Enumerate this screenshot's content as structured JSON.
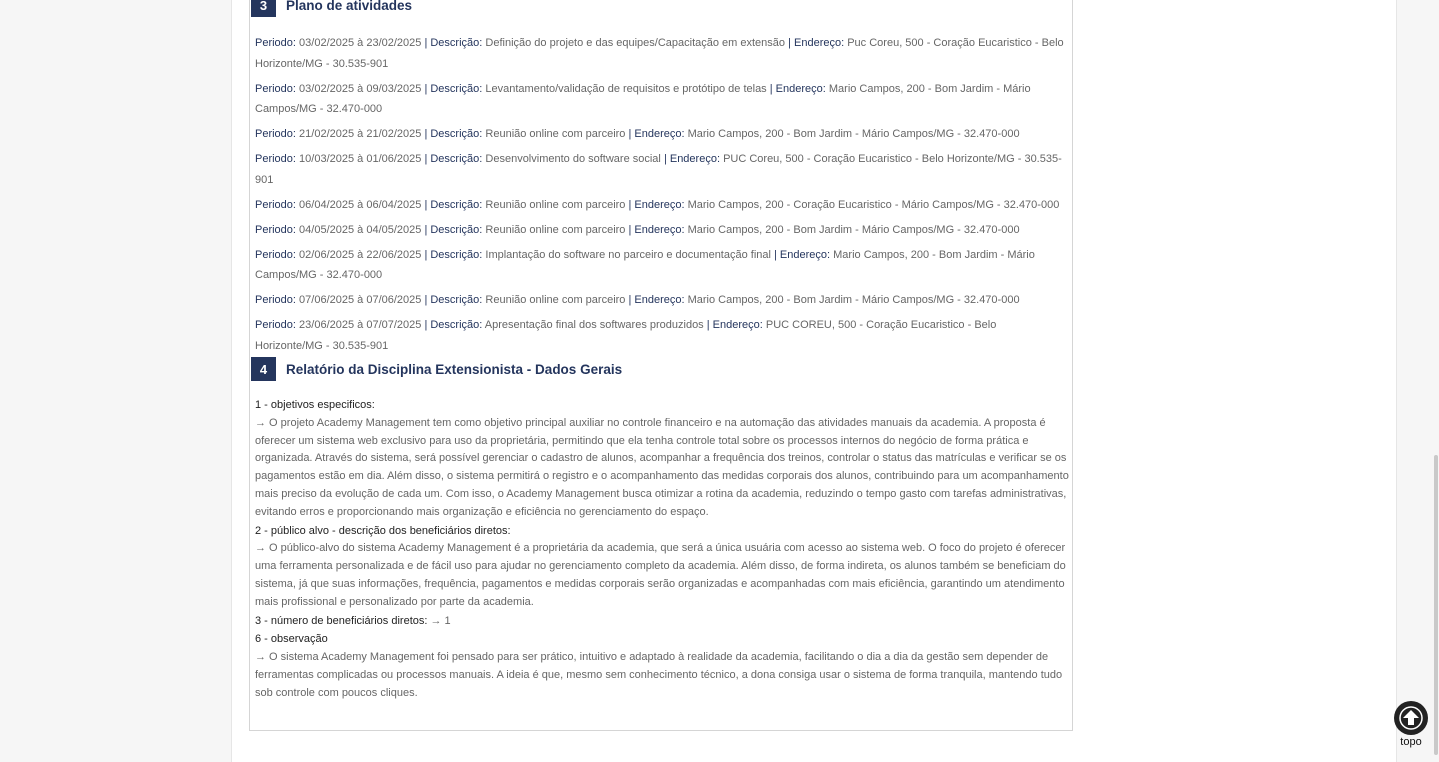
{
  "section3": {
    "number": "3",
    "title": "Plano de atividades",
    "activities": [
      {
        "period_label": "Periodo:",
        "period": "03/02/2025 à 23/02/2025",
        "desc_label": "| Descrição:",
        "desc": "Definição do projeto e das equipes/Capacitação em extensão",
        "addr_label": "| Endereço:",
        "addr": "Puc Coreu, 500 - Coração Eucaristico - Belo Horizonte/MG - 30.535-901"
      },
      {
        "period_label": "Periodo:",
        "period": "03/02/2025 à 09/03/2025",
        "desc_label": "| Descrição:",
        "desc": "Levantamento/validação de requisitos e protótipo de telas",
        "addr_label": "| Endereço:",
        "addr": "Mario Campos, 200 - Bom Jardim - Mário Campos/MG - 32.470-000"
      },
      {
        "period_label": "Periodo:",
        "period": "21/02/2025 à 21/02/2025",
        "desc_label": "| Descrição:",
        "desc": "Reunião online com parceiro",
        "addr_label": "| Endereço:",
        "addr": "Mario Campos, 200 - Bom Jardim - Mário Campos/MG - 32.470-000"
      },
      {
        "period_label": "Periodo:",
        "period": "10/03/2025 à 01/06/2025",
        "desc_label": "| Descrição:",
        "desc": "Desenvolvimento do software social",
        "addr_label": "| Endereço:",
        "addr": "PUC Coreu, 500 - Coração Eucaristico - Belo Horizonte/MG - 30.535-901"
      },
      {
        "period_label": "Periodo:",
        "period": "06/04/2025 à 06/04/2025",
        "desc_label": "| Descrição:",
        "desc": "Reunião online com parceiro",
        "addr_label": "| Endereço:",
        "addr": "Mario Campos, 200 - Coração Eucaristico - Mário Campos/MG - 32.470-000"
      },
      {
        "period_label": "Periodo:",
        "period": "04/05/2025 à 04/05/2025",
        "desc_label": "| Descrição:",
        "desc": "Reunião online com parceiro",
        "addr_label": "| Endereço:",
        "addr": "Mario Campos, 200 - Bom Jardim - Mário Campos/MG - 32.470-000"
      },
      {
        "period_label": "Periodo:",
        "period": "02/06/2025 à 22/06/2025",
        "desc_label": "| Descrição:",
        "desc": "Implantação do software no parceiro e documentação final",
        "addr_label": "| Endereço:",
        "addr": "Mario Campos, 200 - Bom Jardim - Mário Campos/MG - 32.470-000"
      },
      {
        "period_label": "Periodo:",
        "period": "07/06/2025 à 07/06/2025",
        "desc_label": "| Descrição:",
        "desc": "Reunião online com parceiro",
        "addr_label": "| Endereço:",
        "addr": "Mario Campos, 200 - Bom Jardim - Mário Campos/MG - 32.470-000"
      },
      {
        "period_label": "Periodo:",
        "period": "23/06/2025 à 07/07/2025",
        "desc_label": "| Descrição:",
        "desc": "Apresentação final dos softwares produzidos",
        "addr_label": "| Endereço:",
        "addr": "PUC COREU, 500 - Coração Eucaristico - Belo Horizonte/MG - 30.535-901"
      }
    ]
  },
  "section4": {
    "number": "4",
    "title": "Relatório da Disciplina Extensionista - Dados Gerais",
    "q1": "1 - objetivos especificos:",
    "a1": "→ O projeto Academy Management tem como objetivo principal auxiliar no controle financeiro e na automação das atividades manuais da academia. A proposta é oferecer um sistema web exclusivo para uso da proprietária, permitindo que ela tenha controle total sobre os processos internos do negócio de forma prática e organizada. Através do sistema, será possível gerenciar o cadastro de alunos, acompanhar a frequência dos treinos, controlar o status das matrículas e verificar se os pagamentos estão em dia. Além disso, o sistema permitirá o registro e o acompanhamento das medidas corporais dos alunos, contribuindo para um acompanhamento mais preciso da evolução de cada um. Com isso, o Academy Management busca otimizar a rotina da academia, reduzindo o tempo gasto com tarefas administrativas, evitando erros e proporcionando mais organização e eficiência no gerenciamento do espaço.",
    "q2": "2 - público alvo - descrição dos beneficiários diretos:",
    "a2": "→ O público-alvo do sistema Academy Management é a proprietária da academia, que será a única usuária com acesso ao sistema web. O foco do projeto é oferecer uma ferramenta personalizada e de fácil uso para ajudar no gerenciamento completo da academia. Além disso, de forma indireta, os alunos também se beneficiam do sistema, já que suas informações, frequência, pagamentos e medidas corporais serão organizadas e acompanhadas com mais eficiência, garantindo um atendimento mais profissional e personalizado por parte da academia.",
    "q3": "3 - número de beneficiários diretos:",
    "a3": "→ 1",
    "q6": "6 - observação",
    "a6": "→ O sistema Academy Management foi pensado para ser prático, intuitivo e adaptado à realidade da academia, facilitando o dia a dia da gestão sem depender de ferramentas complicadas ou processos manuais. A ideia é que, mesmo sem conhecimento técnico, a dona consiga usar o sistema de forma tranquila, mantendo tudo sob controle com poucos cliques."
  },
  "top_button": {
    "label": "topo",
    "icon": "arrow-up-icon"
  }
}
